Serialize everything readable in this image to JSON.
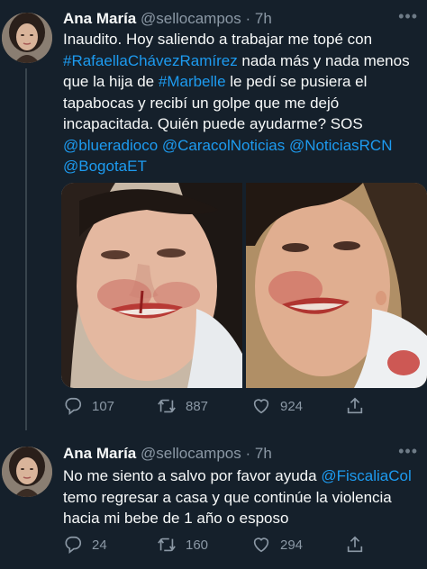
{
  "tweets": [
    {
      "name": "Ana María",
      "handle": "@sellocampos",
      "separator": "·",
      "time": "7h",
      "text_segments": [
        {
          "text": "Inaudito. Hoy saliendo a trabajar me topé con ",
          "link": false
        },
        {
          "text": "#RafaellaChávezRamírez",
          "link": true
        },
        {
          "text": " nada más y nada menos que la hija de ",
          "link": false
        },
        {
          "text": "#Marbelle",
          "link": true
        },
        {
          "text": " le pedí se pusiera el tapabocas y recibí un golpe que me dejó incapacitada. Quién puede ayudarme? SOS ",
          "link": false
        },
        {
          "text": "@blueradioco",
          "link": true
        },
        {
          "text": " ",
          "link": false
        },
        {
          "text": "@CaracolNoticias",
          "link": true
        },
        {
          "text": "  ",
          "link": false
        },
        {
          "text": "@NoticiasRCN",
          "link": true
        },
        {
          "text": " ",
          "link": false
        },
        {
          "text": "@BogotaET",
          "link": true
        }
      ],
      "replies": "107",
      "retweets": "887",
      "likes": "924",
      "has_media": true
    },
    {
      "name": "Ana María",
      "handle": "@sellocampos",
      "separator": "·",
      "time": "7h",
      "text_segments": [
        {
          "text": "No me siento a salvo por favor ayuda ",
          "link": false
        },
        {
          "text": "@FiscaliaCol",
          "link": true
        },
        {
          "text": " temo regresar a casa y que continúe la violencia hacia mi bebe de 1 año o esposo",
          "link": false
        }
      ],
      "replies": "24",
      "retweets": "160",
      "likes": "294",
      "has_media": false
    }
  ],
  "icons": {
    "more": "more-dots-icon",
    "reply": "reply-icon",
    "retweet": "retweet-icon",
    "like": "heart-icon",
    "share": "share-icon"
  },
  "colors": {
    "background": "#15202b",
    "link": "#1d9bf0",
    "secondary_text": "#8b98a5",
    "primary_text": "#f7f9f9"
  }
}
